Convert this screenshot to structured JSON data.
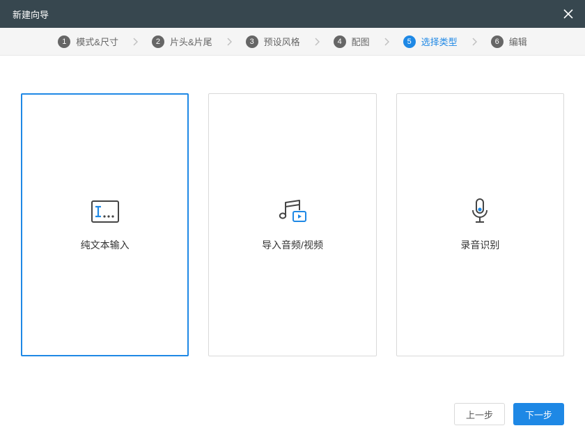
{
  "titlebar": {
    "title": "新建向导"
  },
  "steps": [
    {
      "num": "1",
      "label": "模式&尺寸",
      "active": false
    },
    {
      "num": "2",
      "label": "片头&片尾",
      "active": false
    },
    {
      "num": "3",
      "label": "预设风格",
      "active": false
    },
    {
      "num": "4",
      "label": "配图",
      "active": false
    },
    {
      "num": "5",
      "label": "选择类型",
      "active": true
    },
    {
      "num": "6",
      "label": "编辑",
      "active": false
    }
  ],
  "cards": [
    {
      "label": "纯文本输入",
      "selected": true,
      "icon": "text-input-icon"
    },
    {
      "label": "导入音频/视频",
      "selected": false,
      "icon": "music-video-icon"
    },
    {
      "label": "录音识别",
      "selected": false,
      "icon": "microphone-icon"
    }
  ],
  "footer": {
    "prev": "上一步",
    "next": "下一步"
  },
  "colors": {
    "accent": "#1e88e5",
    "titlebar": "#37474f"
  }
}
